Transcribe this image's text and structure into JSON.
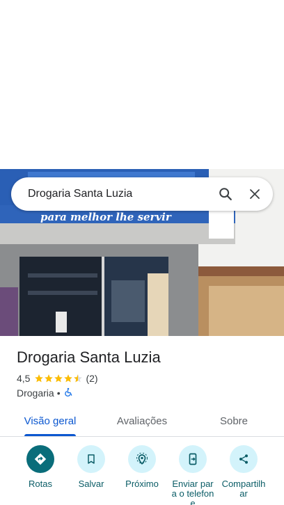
{
  "search": {
    "query": "Drogaria Santa Luzia"
  },
  "photo": {
    "sign_text": "para melhor lhe servir",
    "colors": {
      "sign_blue": "#2a5fb5",
      "wall": "#8a8d90",
      "sky": "#f2f2f0"
    }
  },
  "place": {
    "title": "Drogaria Santa Luzia",
    "rating": "4,5",
    "rating_value": 4.5,
    "reviews": "(2)",
    "category": "Drogaria",
    "separator": "•"
  },
  "tabs": [
    {
      "label": "Visão geral",
      "active": true
    },
    {
      "label": "Avaliações",
      "active": false
    },
    {
      "label": "Sobre",
      "active": false
    }
  ],
  "actions": [
    {
      "label": "Rotas",
      "icon": "directions-icon"
    },
    {
      "label": "Salvar",
      "icon": "bookmark-icon"
    },
    {
      "label": "Próximo",
      "icon": "nearby-icon"
    },
    {
      "label": "Enviar para o telefone",
      "icon": "send-to-phone-icon"
    },
    {
      "label": "Compartilhar",
      "icon": "share-icon"
    }
  ],
  "colors": {
    "accent": "#0b57d0",
    "star": "#fbbc04",
    "action_primary": "#0a6d7a",
    "action_bg": "#d3f3fb",
    "action_text": "#0a5c66"
  }
}
